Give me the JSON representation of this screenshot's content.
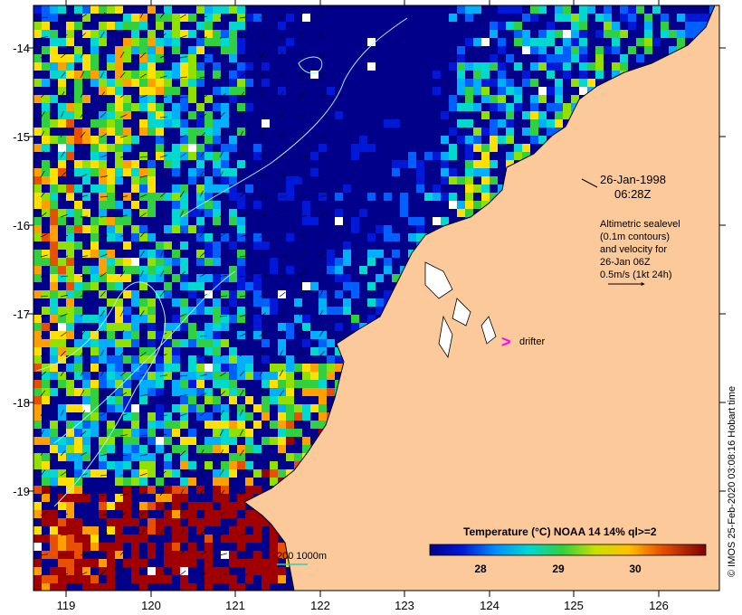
{
  "map": {
    "lon_ticks": [
      "119",
      "120",
      "121",
      "122",
      "123",
      "124",
      "125",
      "126"
    ],
    "lat_ticks": [
      "-14",
      "-15",
      "-16",
      "-17",
      "-18",
      "-19"
    ],
    "date": "26-Jan-1998",
    "time": "06:28Z",
    "notes": [
      "Altimetric sealevel",
      "(0.1m contours)",
      "and velocity for",
      "26-Jan 06Z",
      "0.5m/s (1kt 24h)"
    ],
    "drifter_label": "drifter",
    "scale_label": "200  1000m",
    "colorbar": {
      "title": "Temperature (°C) NOAA 14 14% ql>=2",
      "ticks": [
        "28",
        "29",
        "30"
      ]
    },
    "credit": "© IMOS 25-Feb-2020 03:08:16 Hobart time",
    "colors": {
      "land": "#fbc99a",
      "deep_cold": "#00008b",
      "drifter": "#ff00ff",
      "contour": "#9ff0ff"
    }
  }
}
